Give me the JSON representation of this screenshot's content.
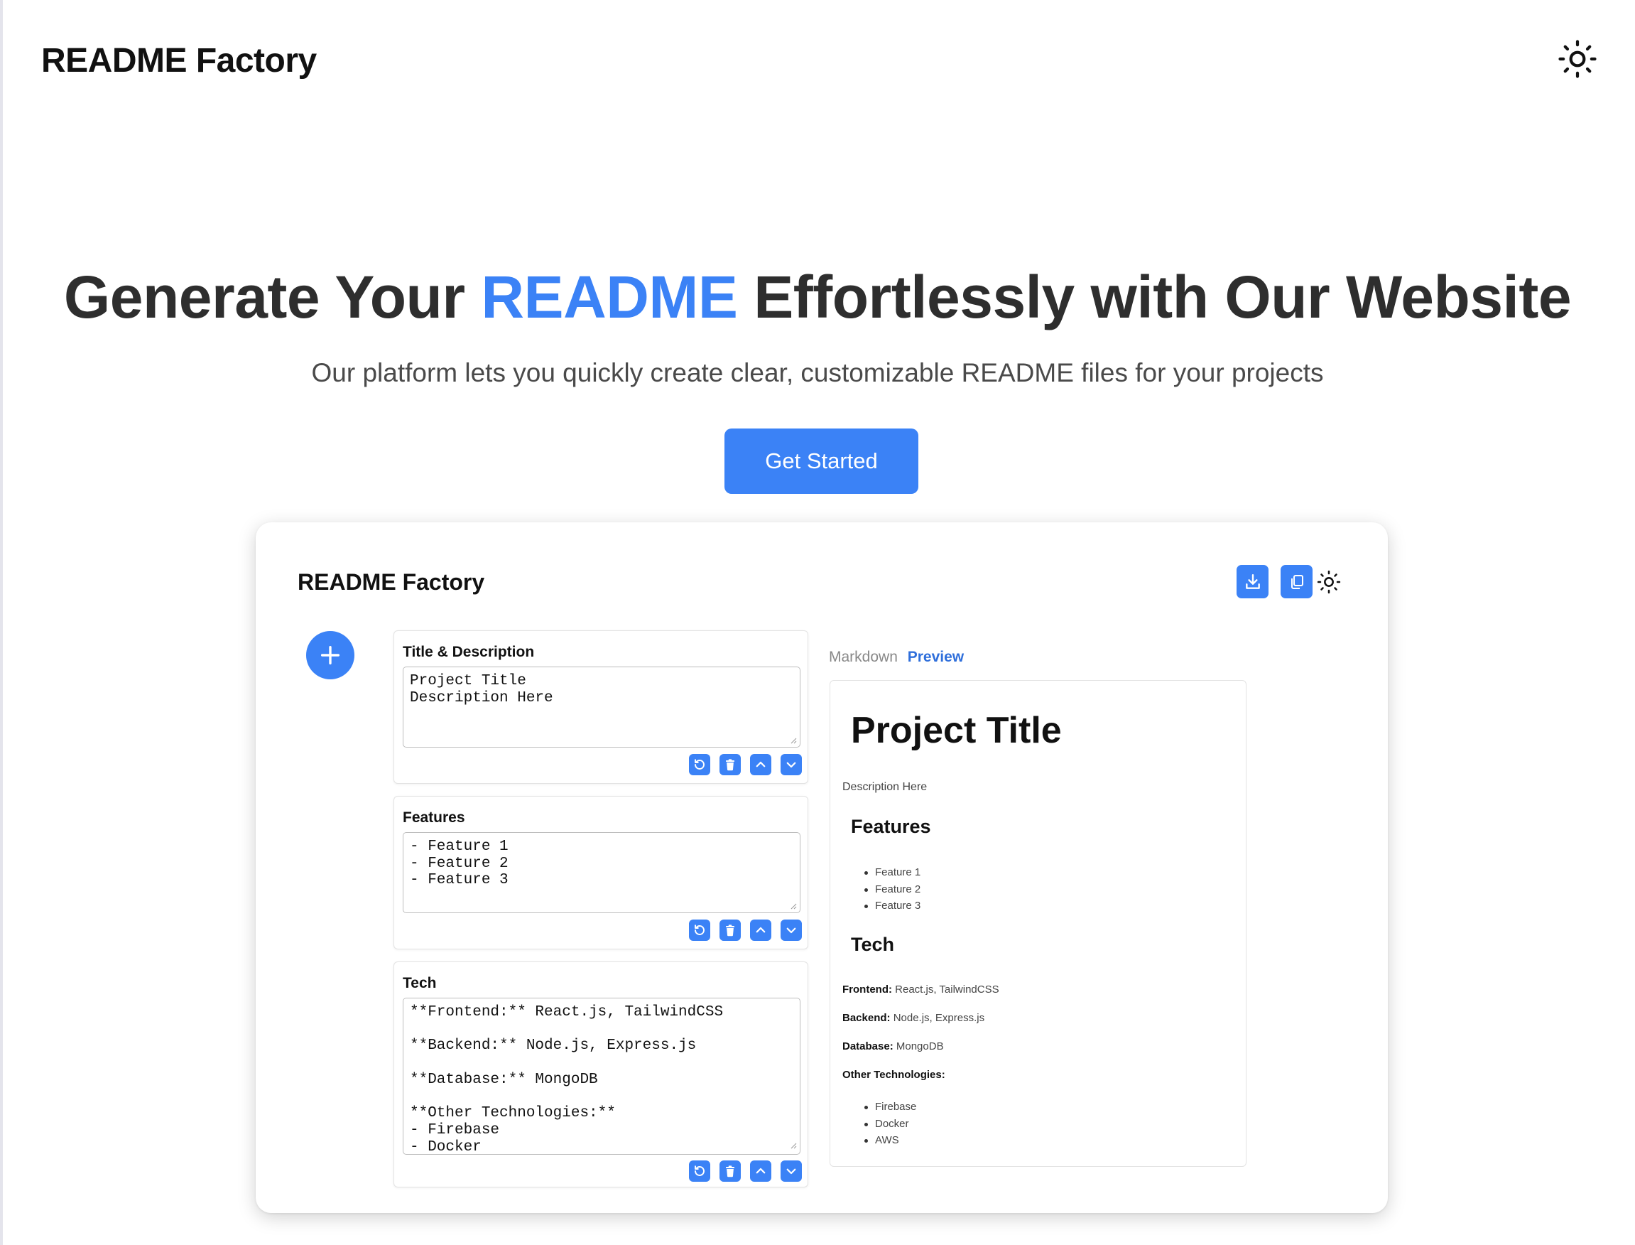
{
  "nav": {
    "logo": "README Factory",
    "theme_icon": "sun-icon"
  },
  "hero": {
    "title_before": "Generate Your ",
    "title_accent": "README",
    "title_after": " Effortlessly with Our Website",
    "subtitle": "Our platform lets you quickly create clear, customizable README files for your projects",
    "cta_label": "Get Started"
  },
  "colors": {
    "accent": "#3b82f6",
    "preview_tab": "#2f6fdb"
  },
  "app": {
    "logo": "README Factory",
    "toolbar": {
      "download_icon": "download-icon",
      "copy_icon": "copy-icon",
      "theme_icon": "sun-icon"
    },
    "add_icon": "plus-icon",
    "sections": [
      {
        "title": "Title & Description",
        "content": "Project Title\nDescription Here"
      },
      {
        "title": "Features",
        "content": "- Feature 1\n- Feature 2\n- Feature 3"
      },
      {
        "title": "Tech",
        "content": "**Frontend:** React.js, TailwindCSS\n\n**Backend:** Node.js, Express.js\n\n**Database:** MongoDB\n\n**Other Technologies:**\n- Firebase\n- Docker"
      }
    ],
    "section_action_icons": [
      "reset-icon",
      "trash-icon",
      "chevron-up-icon",
      "chevron-down-icon"
    ],
    "tabs": {
      "markdown": "Markdown",
      "preview": "Preview"
    },
    "preview": {
      "h1": "Project Title",
      "description": "Description Here",
      "features_heading": "Features",
      "features": [
        "Feature 1",
        "Feature 2",
        "Feature 3"
      ],
      "tech_heading": "Tech",
      "frontend_label": "Frontend:",
      "frontend_value": " React.js, TailwindCSS",
      "backend_label": "Backend:",
      "backend_value": " Node.js, Express.js",
      "database_label": "Database:",
      "database_value": " MongoDB",
      "other_label": "Other Technologies:",
      "other": [
        "Firebase",
        "Docker",
        "AWS"
      ]
    }
  }
}
